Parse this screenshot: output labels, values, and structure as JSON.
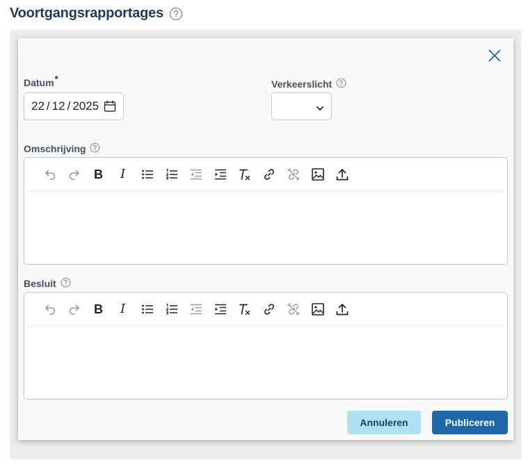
{
  "page": {
    "title": "Voortgangsrapportages"
  },
  "form": {
    "date": {
      "label": "Datum",
      "required_mark": "*",
      "day": "22",
      "month": "12",
      "year": "2025",
      "sep": "/"
    },
    "traffic_light": {
      "label": "Verkeerslicht",
      "value": ""
    },
    "description": {
      "label": "Omschrijving"
    },
    "decision": {
      "label": "Besluit"
    },
    "toolbar": {
      "bold": "B",
      "italic": "I",
      "clear_format": "T"
    },
    "buttons": {
      "cancel": "Annuleren",
      "publish": "Publiceren"
    }
  },
  "colors": {
    "title": "#1d3a5f",
    "primary": "#1f67a8",
    "secondary": "#aee0f6",
    "close": "#1f67a8"
  }
}
